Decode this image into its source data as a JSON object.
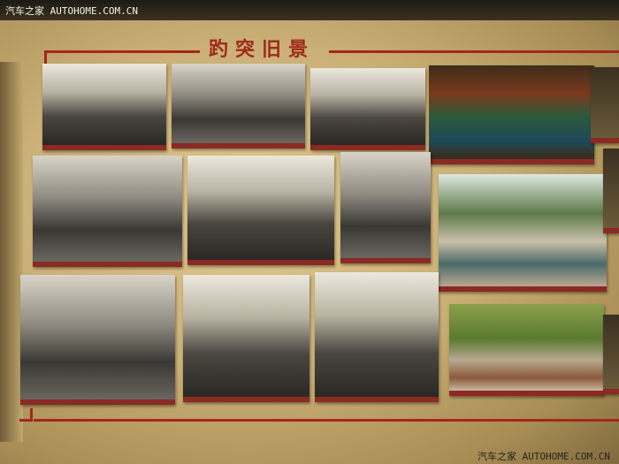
{
  "watermark": {
    "brand": "汽车之家",
    "domain": "AUTOHOME.COM.CN"
  },
  "board": {
    "title": "趵突旧景"
  },
  "colors": {
    "accent_red": "#a3281c",
    "board": "#cbb077"
  }
}
